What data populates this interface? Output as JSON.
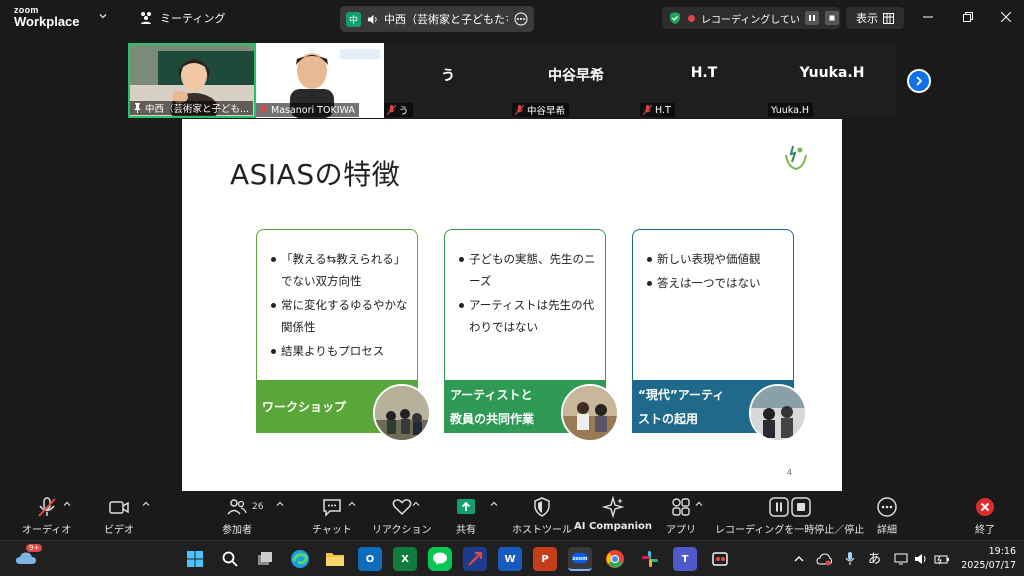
{
  "titlebar": {
    "logo_line1": "zoom",
    "logo_line2": "Workplace",
    "meeting_menu": "ミーティング",
    "share_badge": "中",
    "share_title": "中西（芸術家と子どもたち）の画面",
    "recording_text": "レコーディングしています...",
    "view_menu": "表示"
  },
  "participants": [
    {
      "name": "中西（芸術家と子ども...",
      "pinned": true,
      "video": true
    },
    {
      "name": "Masanori TOKIWA",
      "video": true,
      "muted": true
    },
    {
      "name": "う",
      "big": "う",
      "muted": true
    },
    {
      "name": "中谷早希",
      "big": "中谷早希",
      "muted": true
    },
    {
      "name": "H.T",
      "big": "H.T",
      "muted": true
    },
    {
      "name": "Yuuka.H",
      "big": "Yuuka.H",
      "muted": false
    }
  ],
  "slide": {
    "title": "ASIASの特徴",
    "page": "4",
    "cards": [
      {
        "color": "#5aa63a",
        "items": [
          "「教える⇆教えられる」でない双方向性",
          "常に変化するゆるやかな関係性",
          "結果よりもプロセス"
        ],
        "banner_lines": [
          "ワークショップ"
        ]
      },
      {
        "color": "#2e9a55",
        "items": [
          "子どもの実態、先生のニーズ",
          "アーティストは先生の代わりではない"
        ],
        "banner_lines": [
          "アーティストと",
          "教員の共同作業"
        ]
      },
      {
        "color": "#1f6a8a",
        "items": [
          "新しい表現や価値観",
          "答えは一つではない"
        ],
        "banner_lines": [
          "“現代”アーティ",
          "ストの起用"
        ]
      }
    ]
  },
  "toolbar": {
    "audio": "オーディオ",
    "video": "ビデオ",
    "participants": "参加者",
    "participants_count": "26",
    "chat": "チャット",
    "reactions": "リアクション",
    "share": "共有",
    "host_tools": "ホストツール",
    "ai_companion": "AI Companion",
    "apps": "アプリ",
    "recording": "レコーディングを一時停止／停止",
    "details": "詳細",
    "end": "終了"
  },
  "taskbar": {
    "weather_badge": "9+",
    "ime": "あ",
    "time": "19:16",
    "date": "2025/07/17"
  },
  "colors": {
    "accent_blue": "#0e71eb",
    "share_green": "#0fa06e",
    "end_red": "#e02b2b"
  }
}
